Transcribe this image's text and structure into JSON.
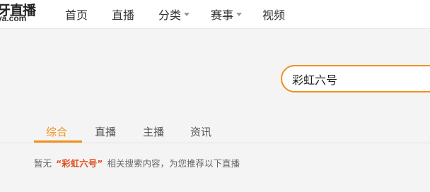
{
  "logo": {
    "main": "牙直播",
    "sub": "ya.com"
  },
  "nav": [
    {
      "label": "首页",
      "has_dropdown": false
    },
    {
      "label": "直播",
      "has_dropdown": false
    },
    {
      "label": "分类",
      "has_dropdown": true
    },
    {
      "label": "赛事",
      "has_dropdown": true
    },
    {
      "label": "视频",
      "has_dropdown": false
    }
  ],
  "search": {
    "value": "彩虹六号"
  },
  "tabs": [
    {
      "label": "综合",
      "active": true
    },
    {
      "label": "直播",
      "active": false
    },
    {
      "label": "主播",
      "active": false
    },
    {
      "label": "资讯",
      "active": false
    }
  ],
  "notice": {
    "prefix": "暂无",
    "keyword": "“彩虹六号”",
    "suffix": "相关搜索内容，为您推荐以下直播"
  },
  "colors": {
    "accent": "#f0901d",
    "keyword": "#e24d1e",
    "background": "#f4f4f4"
  }
}
